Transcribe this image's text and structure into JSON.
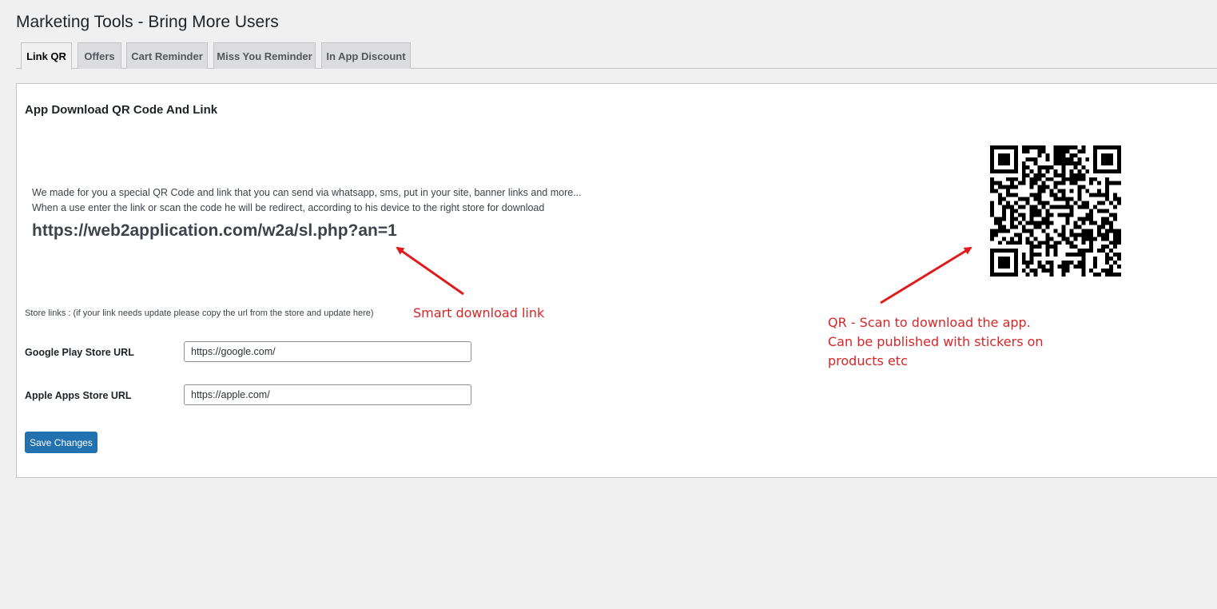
{
  "page": {
    "title": "Marketing Tools - Bring More Users"
  },
  "tabs": [
    {
      "label": "Link QR",
      "active": true
    },
    {
      "label": "Offers",
      "active": false
    },
    {
      "label": "Cart Reminder",
      "active": false
    },
    {
      "label": "Miss You Reminder",
      "active": false
    },
    {
      "label": "In App Discount",
      "active": false
    }
  ],
  "section": {
    "title": "App Download QR Code And Link",
    "description_line1": "We made for you a special QR Code and link that you can send via whatsapp, sms, put in your site, banner links and more...",
    "description_line2": "When a use enter the link or scan the code he will be redirect, according to his device to the right store for download",
    "smart_link": "https://web2application.com/w2a/sl.php?an=1"
  },
  "store_links": {
    "note": "Store links : (if your link needs update please copy the url from the store and update here)",
    "google_label": "Google Play Store URL",
    "google_value": "https://google.com/",
    "apple_label": "Apple Apps Store URL",
    "apple_value": "https://apple.com/"
  },
  "actions": {
    "save_label": "Save Changes"
  },
  "annotations": {
    "smart_link_note": "Smart download link",
    "qr_line1": "QR - Scan to download the app.",
    "qr_line2": "Can be published with stickers on",
    "qr_line3": "products etc"
  },
  "colors": {
    "accent": "#2271b1",
    "annotation": "#d62728",
    "background": "#f0f0f1"
  },
  "icons": {
    "qr": "qr-code-icon"
  }
}
